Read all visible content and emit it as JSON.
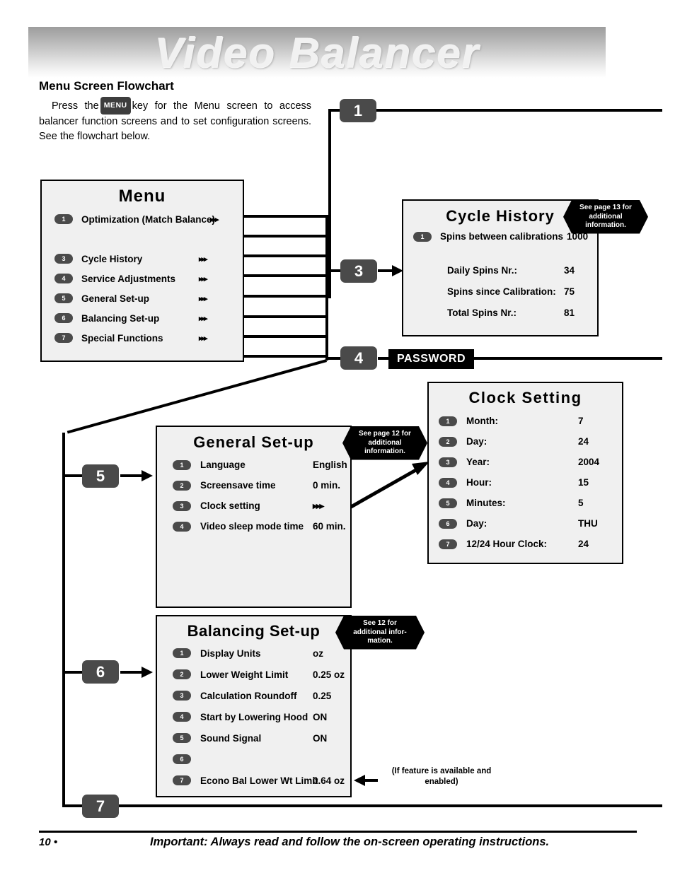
{
  "banner": {
    "title": "Video Balancer"
  },
  "section": {
    "title": "Menu Screen Flowchart",
    "intro_before": "Press the",
    "intro_key": "MENU",
    "intro_after": "key for the Menu screen to access balancer function screens and to set configuration screens. See the flowchart below."
  },
  "menu_panel": {
    "title": "Menu",
    "items": [
      {
        "num": "1",
        "label": "Optimization (Match Balance)",
        "arrows": "▸▸▸"
      },
      {
        "num": "3",
        "label": "Cycle History",
        "arrows": "▸▸▸"
      },
      {
        "num": "4",
        "label": "Service Adjustments",
        "arrows": "▸▸▸"
      },
      {
        "num": "5",
        "label": "General Set-up",
        "arrows": "▸▸▸"
      },
      {
        "num": "6",
        "label": "Balancing Set-up",
        "arrows": "▸▸▸"
      },
      {
        "num": "7",
        "label": "Special Functions",
        "arrows": "▸▸▸"
      }
    ]
  },
  "cycle_panel": {
    "title": "Cycle History",
    "callout": "See page 13 for additional information.",
    "first": {
      "num": "1",
      "label": "Spins between calibrations",
      "value": "1000"
    },
    "stats": [
      {
        "label": "Daily Spins Nr.:",
        "value": "34"
      },
      {
        "label": "Spins since Calibration:",
        "value": "75"
      },
      {
        "label": "Total Spins Nr.:",
        "value": "81"
      }
    ]
  },
  "clock_panel": {
    "title": "Clock Setting",
    "items": [
      {
        "num": "1",
        "label": "Month:",
        "value": "7"
      },
      {
        "num": "2",
        "label": "Day:",
        "value": "24"
      },
      {
        "num": "3",
        "label": "Year:",
        "value": "2004"
      },
      {
        "num": "4",
        "label": "Hour:",
        "value": "15"
      },
      {
        "num": "5",
        "label": "Minutes:",
        "value": "5"
      },
      {
        "num": "6",
        "label": "Day:",
        "value": "THU"
      },
      {
        "num": "7",
        "label": "12/24 Hour Clock:",
        "value": "24"
      }
    ]
  },
  "general_panel": {
    "title": "General Set-up",
    "callout": "See page 12 for additional information.",
    "items": [
      {
        "num": "1",
        "label": "Language",
        "value": "English"
      },
      {
        "num": "2",
        "label": "Screensave time",
        "value": "0 min."
      },
      {
        "num": "3",
        "label": "Clock setting",
        "value": "▸▸▸"
      },
      {
        "num": "4",
        "label": "Video sleep mode time",
        "value": "60 min."
      }
    ]
  },
  "balancing_panel": {
    "title": "Balancing Set-up",
    "callout": "See 12 for additional infor- mation.",
    "items": [
      {
        "num": "1",
        "label": "Display Units",
        "value": "oz"
      },
      {
        "num": "2",
        "label": "Lower Weight Limit",
        "value": "0.25 oz"
      },
      {
        "num": "3",
        "label": "Calculation Roundoff",
        "value": "0.25"
      },
      {
        "num": "4",
        "label": "Start by Lowering Hood",
        "value": "ON"
      },
      {
        "num": "5",
        "label": "Sound Signal",
        "value": "ON"
      },
      {
        "num": "6",
        "label": "",
        "value": ""
      },
      {
        "num": "7",
        "label": "Econo Bal Lower Wt Limit",
        "value": "0.64 oz"
      }
    ]
  },
  "steps": {
    "s1": "1",
    "s3": "3",
    "s4": "4",
    "s5": "5",
    "s6": "6",
    "s7": "7"
  },
  "password_tag": "PASSWORD",
  "feature_note": "(If feature is available and enabled)",
  "footer": {
    "page": "10 •",
    "text": "Important: Always read and follow the on-screen operating instructions."
  }
}
